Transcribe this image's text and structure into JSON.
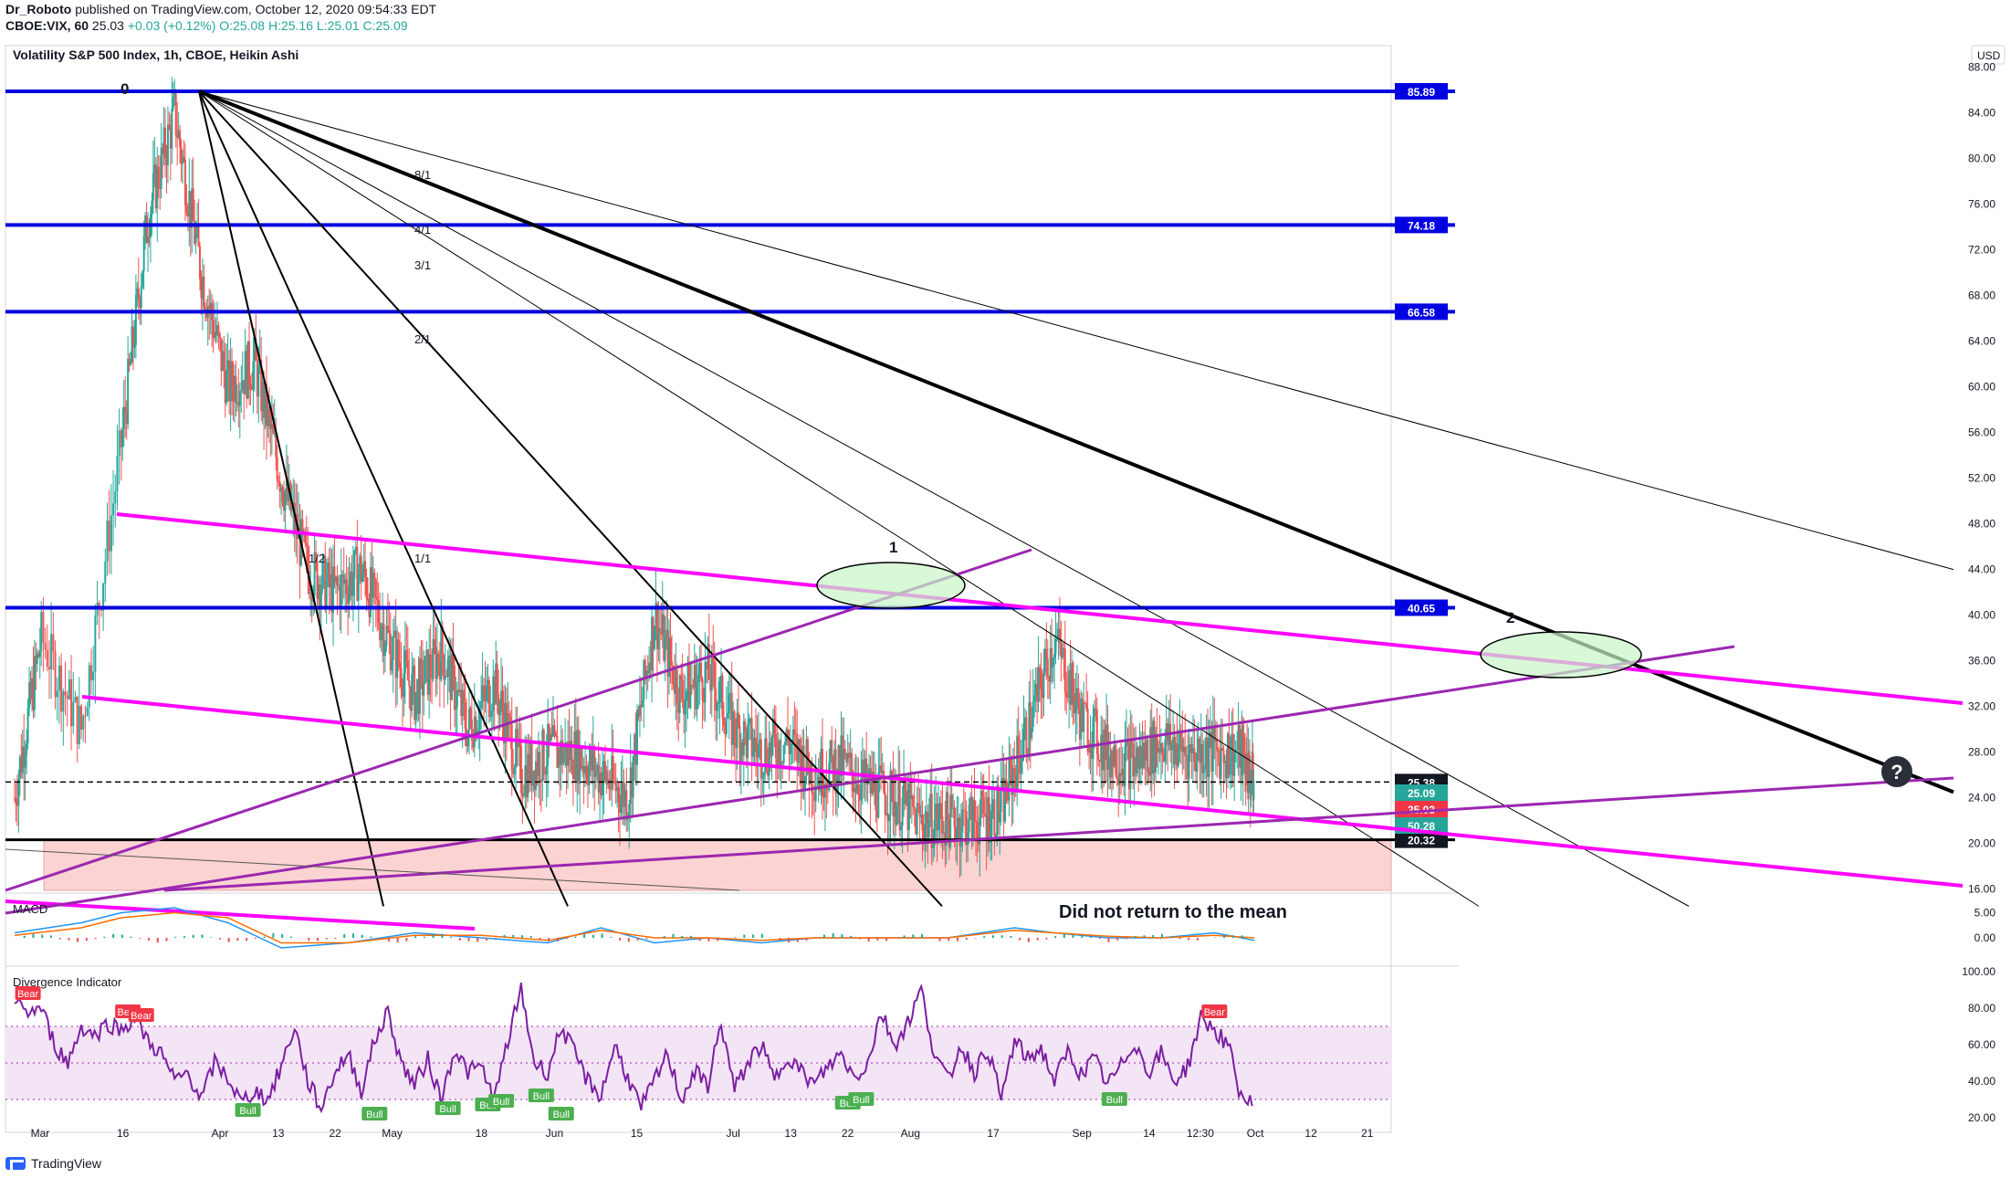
{
  "header": {
    "publisher": "Dr_Roboto",
    "published_text": "published on TradingView.com, October 12, 2020 09:54:33 EDT",
    "symbol": "CBOE:VIX, 60",
    "last": "25.03",
    "change": "+0.03 (+0.12%)",
    "ohlc": "O:25.08 H:25.16 L:25.01 C:25.09"
  },
  "chart_title": "Volatility S&P 500 Index, 1h, CBOE, Heikin Ashi",
  "currency": "USD",
  "colors": {
    "blue_line": "#0000e0",
    "magenta_line": "#ff00ff",
    "purple_line": "#9c27b0",
    "fan_line": "#000000",
    "candle_up": "#26a69a",
    "candle_down": "#ef5350",
    "zone_fill": "#fbd3d3",
    "ellipse_fill": "#c8f5c8",
    "macd_line": "#2196f3",
    "signal_line": "#ff6d00",
    "rsi_line": "#7b1fa2",
    "rsi_band": "#f3e5f5",
    "bull_label": "#4caf50",
    "bear_label": "#f23645"
  },
  "annotations": {
    "point_0": "0",
    "point_1": "1",
    "point_2": "2",
    "zone_text": "Did not return to the mean",
    "question_icon": "question-mark",
    "fan_labels": [
      "8/1",
      "4/1",
      "3/1",
      "2/1",
      "1/1",
      "1/2"
    ]
  },
  "chart_data": [
    {
      "type": "line",
      "name": "main-price",
      "style": "heikin-ashi-candles",
      "x_ticks": [
        "Mar",
        "16",
        "Apr",
        "13",
        "22",
        "May",
        "18",
        "Jun",
        "15",
        "Jul",
        "13",
        "22",
        "Aug",
        "17",
        "Sep",
        "14",
        "12:30",
        "Oct",
        "12",
        "21"
      ],
      "y_ticks": [
        88,
        84,
        80,
        76,
        72,
        68,
        64,
        60,
        56,
        52,
        48,
        44,
        40,
        36,
        32,
        28,
        24,
        20,
        16
      ],
      "ylim": [
        14,
        91
      ],
      "horizontal_levels": [
        {
          "value": 85.89,
          "label": "85.89",
          "color": "blue"
        },
        {
          "value": 74.18,
          "label": "74.18",
          "color": "blue"
        },
        {
          "value": 66.58,
          "label": "66.58",
          "color": "blue"
        },
        {
          "value": 40.65,
          "label": "40.65",
          "color": "blue"
        },
        {
          "value": 20.32,
          "label": "20.32",
          "color": "black"
        },
        {
          "value": 25.38,
          "label": "25.38",
          "color": "dashed"
        }
      ],
      "price_tags": [
        {
          "value": 25.09,
          "label": "25.09",
          "color": "#26a69a"
        },
        {
          "value": 25.03,
          "label": "25.03",
          "color": "#f23645"
        },
        {
          "value": 50.28,
          "label": "50.28",
          "color": "#26a69a"
        }
      ],
      "series": [
        {
          "x": [
            0,
            0.02,
            0.05,
            0.08,
            0.1,
            0.12,
            0.14,
            0.16,
            0.18,
            0.2,
            0.22,
            0.24,
            0.26,
            0.28,
            0.3,
            0.32,
            0.34,
            0.36,
            0.38,
            0.4,
            0.42,
            0.44,
            0.46,
            0.48,
            0.5,
            0.52,
            0.54,
            0.56,
            0.58,
            0.6,
            0.62,
            0.64,
            0.66,
            0.68,
            0.7,
            0.72,
            0.74,
            0.76,
            0.78,
            0.8,
            0.82,
            0.84,
            0.86,
            0.88,
            0.9,
            0.92,
            0.93
          ],
          "y": [
            24,
            38,
            30,
            55,
            75,
            84,
            70,
            60,
            62,
            52,
            44,
            42,
            44,
            38,
            33,
            37,
            30,
            34,
            26,
            28,
            28,
            26,
            24,
            40,
            33,
            35,
            30,
            28,
            29,
            26,
            27,
            25,
            24,
            22,
            22,
            22,
            23,
            30,
            38,
            31,
            28,
            27,
            29,
            28,
            28,
            28,
            25
          ]
        }
      ]
    },
    {
      "type": "line",
      "name": "MACD",
      "y_ticks": [
        5.0,
        0.0
      ],
      "y_tick_labels": [
        "5.00",
        "0.00"
      ],
      "ylim": [
        -4,
        8
      ],
      "series": [
        {
          "x": [
            0,
            0.05,
            0.08,
            0.12,
            0.16,
            0.2,
            0.25,
            0.3,
            0.35,
            0.4,
            0.44,
            0.48,
            0.52,
            0.56,
            0.6,
            0.65,
            0.7,
            0.75,
            0.78,
            0.82,
            0.86,
            0.9,
            0.93
          ],
          "y": [
            1,
            3,
            5,
            6,
            3,
            -2,
            -1,
            1,
            0,
            -1,
            2,
            -1,
            0,
            -1,
            0,
            0,
            0,
            2,
            1,
            0,
            0,
            1,
            -0.5
          ]
        },
        {
          "x": [
            0,
            0.05,
            0.08,
            0.12,
            0.16,
            0.2,
            0.25,
            0.3,
            0.35,
            0.4,
            0.44,
            0.48,
            0.52,
            0.56,
            0.6,
            0.65,
            0.7,
            0.75,
            0.78,
            0.82,
            0.86,
            0.9,
            0.93
          ],
          "y": [
            0.5,
            2,
            4,
            5,
            4,
            -1,
            -1,
            0.5,
            0.5,
            -0.5,
            1.5,
            0,
            0,
            -0.5,
            0,
            0,
            0,
            1.5,
            1,
            0.3,
            0,
            0.5,
            0
          ]
        }
      ]
    },
    {
      "type": "line",
      "name": "Divergence Indicator",
      "title": "Divergence Indicator",
      "y_ticks": [
        100,
        80,
        60,
        40,
        20
      ],
      "y_tick_labels": [
        "100.00",
        "80.00",
        "60.00",
        "40.00",
        "20.00"
      ],
      "ylim": [
        15,
        100
      ],
      "band": [
        30,
        70
      ],
      "series": [
        {
          "x": [
            0,
            0.01,
            0.02,
            0.03,
            0.04,
            0.05,
            0.06,
            0.07,
            0.08,
            0.09,
            0.1,
            0.11,
            0.12,
            0.13,
            0.14,
            0.15,
            0.16,
            0.17,
            0.18,
            0.19,
            0.2,
            0.21,
            0.22,
            0.23,
            0.24,
            0.25,
            0.26,
            0.27,
            0.28,
            0.29,
            0.3,
            0.31,
            0.32,
            0.33,
            0.34,
            0.35,
            0.36,
            0.37,
            0.38,
            0.39,
            0.4,
            0.41,
            0.42,
            0.43,
            0.44,
            0.45,
            0.46,
            0.47,
            0.48,
            0.49,
            0.5,
            0.51,
            0.52,
            0.53,
            0.54,
            0.55,
            0.56,
            0.57,
            0.58,
            0.59,
            0.6,
            0.61,
            0.62,
            0.63,
            0.64,
            0.65,
            0.66,
            0.67,
            0.68,
            0.69,
            0.7,
            0.71,
            0.72,
            0.73,
            0.74,
            0.75,
            0.76,
            0.77,
            0.78,
            0.79,
            0.8,
            0.81,
            0.82,
            0.83,
            0.84,
            0.85,
            0.86,
            0.87,
            0.88,
            0.89,
            0.9,
            0.91,
            0.92,
            0.93
          ],
          "y": [
            82,
            78,
            80,
            60,
            50,
            70,
            65,
            72,
            68,
            75,
            62,
            55,
            40,
            45,
            30,
            50,
            42,
            28,
            35,
            30,
            48,
            70,
            40,
            25,
            45,
            55,
            35,
            62,
            78,
            50,
            38,
            52,
            30,
            58,
            45,
            48,
            30,
            62,
            90,
            50,
            45,
            70,
            55,
            40,
            32,
            60,
            42,
            25,
            40,
            55,
            30,
            45,
            38,
            72,
            35,
            50,
            60,
            40,
            55,
            45,
            38,
            48,
            55,
            42,
            50,
            78,
            60,
            72,
            90,
            55,
            40,
            60,
            45,
            58,
            30,
            62,
            52,
            58,
            40,
            56,
            44,
            52,
            38,
            48,
            62,
            45,
            55,
            40,
            48,
            75,
            68,
            60,
            32,
            26
          ]
        }
      ],
      "labels": [
        {
          "text": "Bear",
          "x": 0.01,
          "y": 88
        },
        {
          "text": "Bear",
          "x": 0.085,
          "y": 78
        },
        {
          "text": "Bear",
          "x": 0.095,
          "y": 76
        },
        {
          "text": "Bull",
          "x": 0.175,
          "y": 24
        },
        {
          "text": "Bull",
          "x": 0.27,
          "y": 22
        },
        {
          "text": "Bull",
          "x": 0.325,
          "y": 25
        },
        {
          "text": "Bull",
          "x": 0.355,
          "y": 27
        },
        {
          "text": "Bull",
          "x": 0.365,
          "y": 29
        },
        {
          "text": "Bull",
          "x": 0.395,
          "y": 32
        },
        {
          "text": "Bull",
          "x": 0.41,
          "y": 22
        },
        {
          "text": "Bull",
          "x": 0.625,
          "y": 28
        },
        {
          "text": "Bull",
          "x": 0.635,
          "y": 30
        },
        {
          "text": "Bull",
          "x": 0.825,
          "y": 30
        },
        {
          "text": "Bear",
          "x": 0.9,
          "y": 78
        }
      ]
    }
  ],
  "footer": {
    "brand": "TradingView"
  }
}
